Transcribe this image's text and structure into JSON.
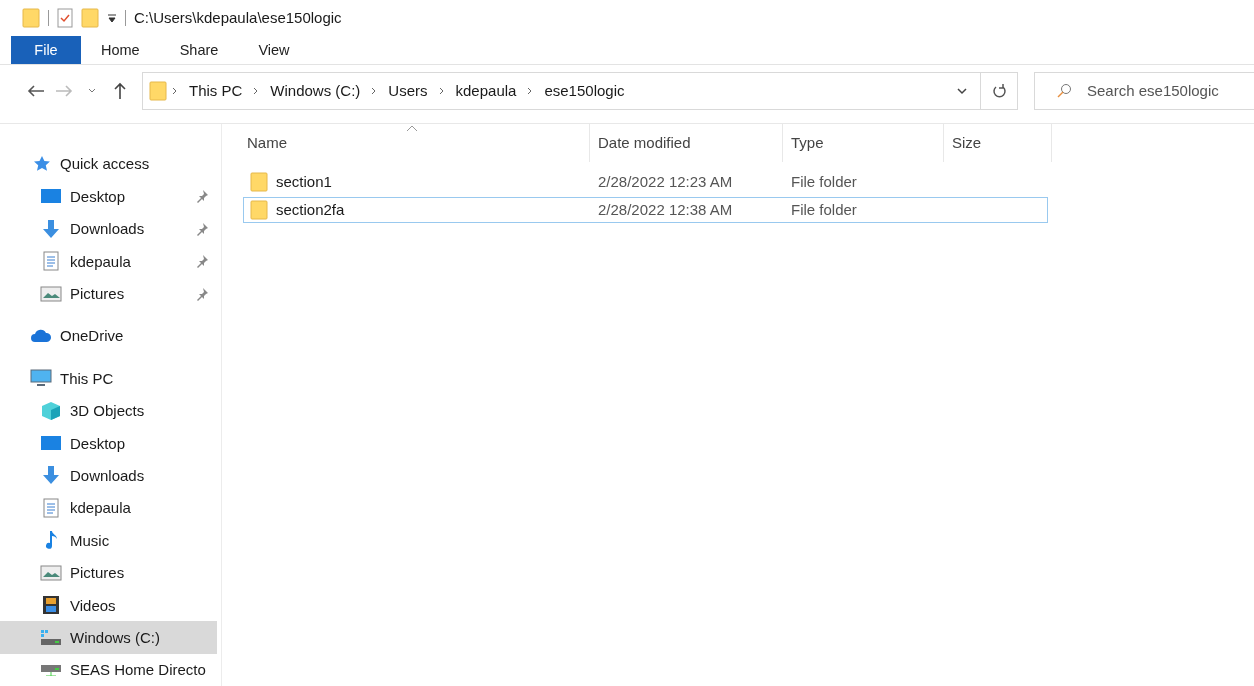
{
  "window": {
    "title": "C:\\Users\\kdepaula\\ese150logic"
  },
  "ribbon_tabs": [
    {
      "label": "File",
      "kind": "file",
      "selected": false
    },
    {
      "label": "Home",
      "kind": "tab",
      "selected": false
    },
    {
      "label": "Share",
      "kind": "tab",
      "selected": false
    },
    {
      "label": "View",
      "kind": "tab",
      "selected": false
    }
  ],
  "address_bar": {
    "path": [
      "This PC",
      "Windows (C:)",
      "Users",
      "kdepaula",
      "ese150logic"
    ]
  },
  "search": {
    "placeholder": "Search ese150logic"
  },
  "sidebar": {
    "items": [
      {
        "label": "Quick access",
        "kind": "star",
        "selected": false,
        "children": [
          {
            "label": "Desktop",
            "kind": "desktop",
            "pinned": true,
            "selected": false
          },
          {
            "label": "Downloads",
            "kind": "download",
            "pinned": true,
            "selected": false
          },
          {
            "label": "kdepaula",
            "kind": "document",
            "pinned": true,
            "selected": false
          },
          {
            "label": "Pictures",
            "kind": "pictures",
            "pinned": true,
            "selected": false
          }
        ]
      },
      {
        "label": "OneDrive",
        "kind": "cloud",
        "selected": false
      },
      {
        "label": "This PC",
        "kind": "computer",
        "selected": false,
        "children": [
          {
            "label": "3D Objects",
            "kind": "cube",
            "selected": false
          },
          {
            "label": "Desktop",
            "kind": "desktop",
            "selected": false
          },
          {
            "label": "Downloads",
            "kind": "download",
            "selected": false
          },
          {
            "label": "kdepaula",
            "kind": "document",
            "selected": false
          },
          {
            "label": "Music",
            "kind": "music",
            "selected": false
          },
          {
            "label": "Pictures",
            "kind": "pictures",
            "selected": false
          },
          {
            "label": "Videos",
            "kind": "video",
            "selected": false
          },
          {
            "label": "Windows (C:)",
            "kind": "drive",
            "selected": true
          },
          {
            "label": "SEAS Home Directo",
            "kind": "netdrive",
            "selected": false
          }
        ]
      }
    ]
  },
  "table": {
    "columns": [
      "Name",
      "Date modified",
      "Type",
      "Size"
    ],
    "rows": [
      {
        "name": "section1",
        "date": "2/28/2022 12:23 AM",
        "type": "File folder",
        "focused": false
      },
      {
        "name": "section2fa",
        "date": "2/28/2022 12:38 AM",
        "type": "File folder",
        "focused": true
      }
    ]
  }
}
